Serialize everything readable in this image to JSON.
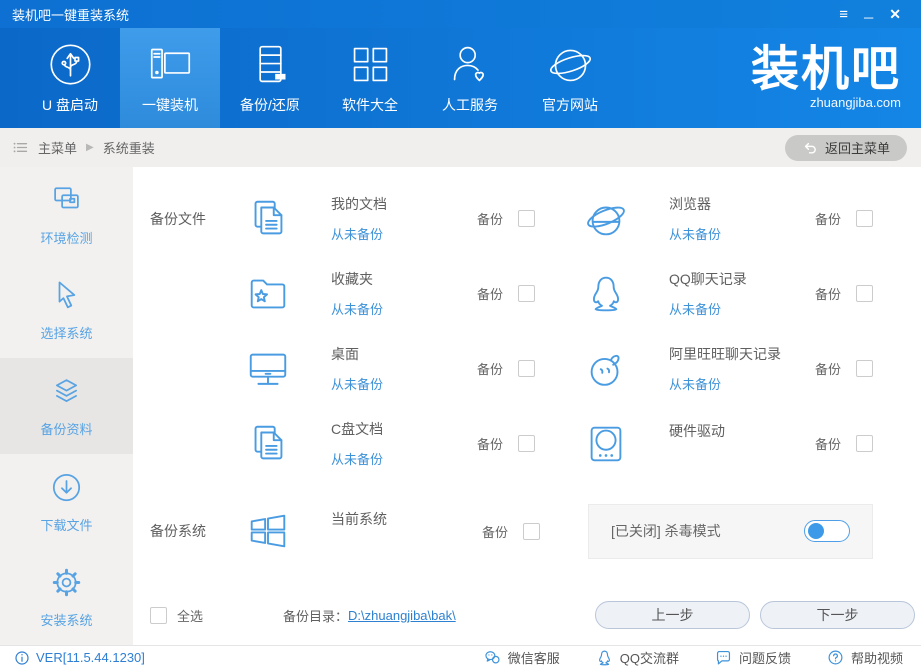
{
  "window": {
    "title": "装机吧一键重装系统",
    "controls": {
      "menu": "≡",
      "minimize": "─",
      "close": "✕"
    }
  },
  "nav": {
    "tabs": [
      {
        "label": "U 盘启动"
      },
      {
        "label": "一键装机"
      },
      {
        "label": "备份/还原"
      },
      {
        "label": "软件大全"
      },
      {
        "label": "人工服务"
      },
      {
        "label": "官方网站"
      }
    ],
    "logo": {
      "text": "装机吧",
      "domain": "zhuangjiba.com"
    }
  },
  "breadcrumb": {
    "root": "主菜单",
    "separator": "▶",
    "current": "系统重装",
    "back_button": "返回主菜单"
  },
  "sidebar": {
    "items": [
      {
        "label": "环境检测"
      },
      {
        "label": "选择系统"
      },
      {
        "label": "备份资料"
      },
      {
        "label": "下载文件"
      },
      {
        "label": "安装系统"
      }
    ]
  },
  "main": {
    "file_section_label": "备份文件",
    "system_section_label": "备份系统",
    "backup_label": "备份",
    "file_items": [
      {
        "name": "我的文档",
        "status": "从未备份"
      },
      {
        "name": "浏览器",
        "status": "从未备份"
      },
      {
        "name": "收藏夹",
        "status": "从未备份"
      },
      {
        "name": "QQ聊天记录",
        "status": "从未备份"
      },
      {
        "name": "桌面",
        "status": "从未备份"
      },
      {
        "name": "阿里旺旺聊天记录",
        "status": "从未备份"
      },
      {
        "name": "C盘文档",
        "status": "从未备份"
      },
      {
        "name": "硬件驱动",
        "status": ""
      }
    ],
    "system_item": {
      "name": "当前系统",
      "status": ""
    },
    "antivirus": {
      "label": "[已关闭] 杀毒模式",
      "state": "off"
    },
    "select_all_label": "全选",
    "backup_dir_label": "备份目录：",
    "backup_dir_path": "D:\\zhuangjiba\\bak\\",
    "prev_button": "上一步",
    "next_button": "下一步"
  },
  "footer": {
    "version": "VER[11.5.44.1230]",
    "links": [
      {
        "label": "微信客服"
      },
      {
        "label": "QQ交流群"
      },
      {
        "label": "问题反馈"
      },
      {
        "label": "帮助视频"
      }
    ]
  },
  "colors": {
    "accent_blue": "#1486e6",
    "icon_blue": "#4a9ce2",
    "status_blue": "#3e92d8",
    "link_blue": "#2e81d0"
  }
}
